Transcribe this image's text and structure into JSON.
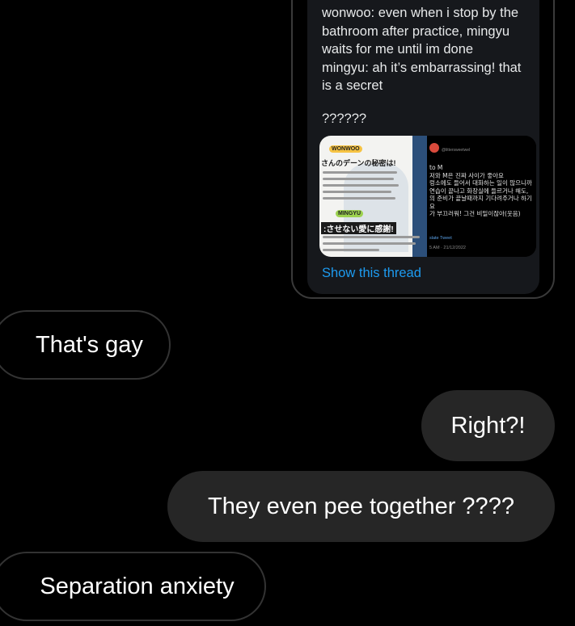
{
  "tweet": {
    "text": "wonwoo: even when i stop by the\nbathroom after practice, mingyu\nwaits for me until im done\nmingyu: ah it’s embarrassing! that\nis a secret",
    "question_marks": "??????",
    "show_thread": "Show this thread",
    "media": {
      "left_tags": [
        "WONWOO",
        "MINGYU"
      ],
      "left_headlines": [
        "さんのデーンの秘密は!",
        ":させない愛に感謝!"
      ],
      "right_handle": "@littersweetwel",
      "right_text": "to M\n저와 M은 진짜 사이가 좋아요\n렁소에도 들어서 대화하는 일이 많으니까\n연습이 끝나고 화장실에 들르거나 해도,\n의 준비가 끝날때까지 기다려주거나 하기\n요\n가 부끄러워! 그건 비밀이잖아(웃음)",
      "right_link": "slate Tweet",
      "right_time": "5 AM · 21/12/2022"
    }
  },
  "messages": [
    {
      "side": "received",
      "text": "That's gay"
    },
    {
      "side": "sent",
      "text": "Right?!"
    },
    {
      "side": "sent",
      "text": "They even pee together ????"
    },
    {
      "side": "received",
      "text": "Separation anxiety"
    }
  ],
  "colors": {
    "background": "#000000",
    "sent_bubble": "#262626",
    "received_border": "#333333",
    "tweet_bg": "#16181c",
    "link": "#1d9bf0"
  }
}
